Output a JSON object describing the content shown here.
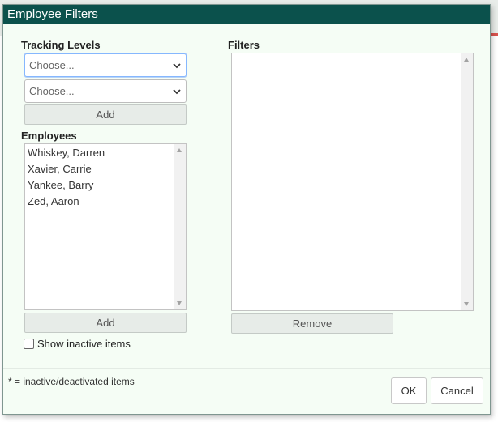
{
  "dialog": {
    "title": "Employee Filters",
    "tracking_levels_label": "Tracking Levels",
    "select_1": {
      "value": "Choose..."
    },
    "select_2": {
      "value": "Choose..."
    },
    "add_label_1": "Add",
    "employees_label": "Employees",
    "employees": [
      "Whiskey, Darren",
      "Xavier, Carrie",
      "Yankee, Barry",
      "Zed, Aaron"
    ],
    "add_label_2": "Add",
    "show_inactive_label": "Show inactive items",
    "show_inactive_checked": false,
    "filters_label": "Filters",
    "filters_items": [],
    "remove_label": "Remove",
    "footer_note": "* = inactive/deactivated items",
    "ok_label": "OK",
    "cancel_label": "Cancel"
  },
  "colors": {
    "titlebar": "#0b514c",
    "dialog_bg": "#f5fdf5",
    "focus_border": "#86b7fe",
    "accent_red": "#d9534f"
  },
  "icons": [
    "chevron-down-icon",
    "scroll-up-arrow-icon",
    "scroll-down-arrow-icon"
  ]
}
